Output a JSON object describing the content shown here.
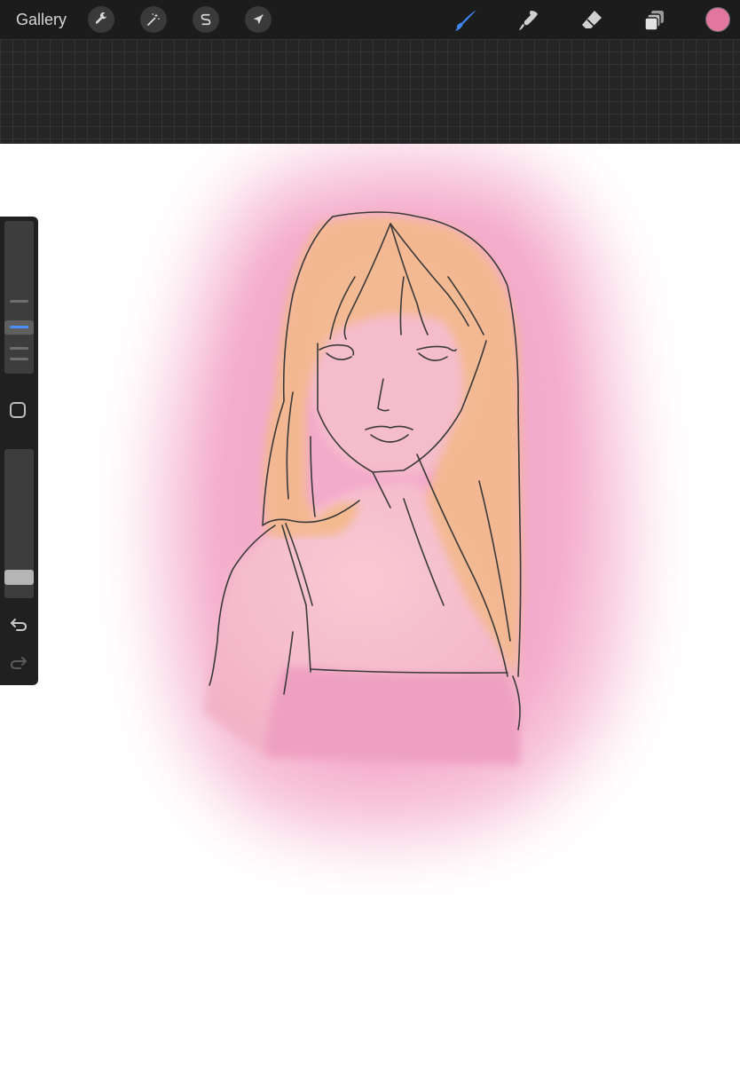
{
  "toolbar": {
    "gallery_label": "Gallery",
    "left_tools": [
      {
        "name": "actions",
        "icon": "wrench-icon"
      },
      {
        "name": "adjustments",
        "icon": "magic-wand-icon"
      },
      {
        "name": "selection",
        "icon": "selection-s-icon"
      },
      {
        "name": "transform",
        "icon": "arrow-cursor-icon"
      }
    ],
    "right_tools": [
      {
        "name": "brush",
        "icon": "brush-icon",
        "active": true
      },
      {
        "name": "smudge",
        "icon": "smudge-icon",
        "active": false
      },
      {
        "name": "eraser",
        "icon": "eraser-icon",
        "active": false
      },
      {
        "name": "layers",
        "icon": "layers-icon",
        "active": false
      }
    ],
    "current_color": "#e1779f"
  },
  "colors": {
    "toolbar_bg": "#1c1c1c",
    "grid_bg": "#252525",
    "active_tool": "#3f86f5",
    "inactive_tool": "#d0d0d0",
    "canvas_bg": "#ffffff",
    "watercolor_pink": "#f2a7c6",
    "hair_peach": "#f2b68e",
    "skin_pink": "#f6c4cc",
    "top_pink": "#ec9fc0",
    "line_art": "#3a3a3a"
  },
  "sidebar": {
    "brush_size_level": 0.72,
    "opacity_level": 0.9,
    "modify_button": "square-icon",
    "undo": "undo-icon",
    "redo": "redo-icon"
  }
}
